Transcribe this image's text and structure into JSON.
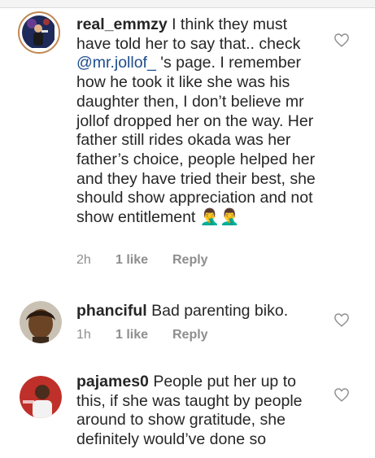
{
  "comments": [
    {
      "username": "real_emmzy",
      "text_before": " I think they must have told her to say that.. check ",
      "mention": "@mr.jollof_",
      "text_after": " 's page. I remember how he took it like she was his daughter then, I don’t believe mr jollof dropped her on the way. Her father still rides okada was her father’s choice, people helped her and they have tried their best, she should show appreciation and not show entitlement 🤦‍♂️🤦‍♂️",
      "time": "2h",
      "likes": "1 like",
      "reply": "Reply"
    },
    {
      "username": "phanciful",
      "text": " Bad parenting biko.",
      "time": "1h",
      "likes": "1 like",
      "reply": "Reply"
    },
    {
      "username": "pajames0",
      "text": " People put her up to this, if she was taught by people around to show gratitude, she definitely would’ve done so"
    }
  ],
  "icons": {
    "like": "heart-outline-icon"
  },
  "colors": {
    "text": "#262626",
    "meta": "#8e8e8e",
    "mention": "#1e4d8c"
  }
}
